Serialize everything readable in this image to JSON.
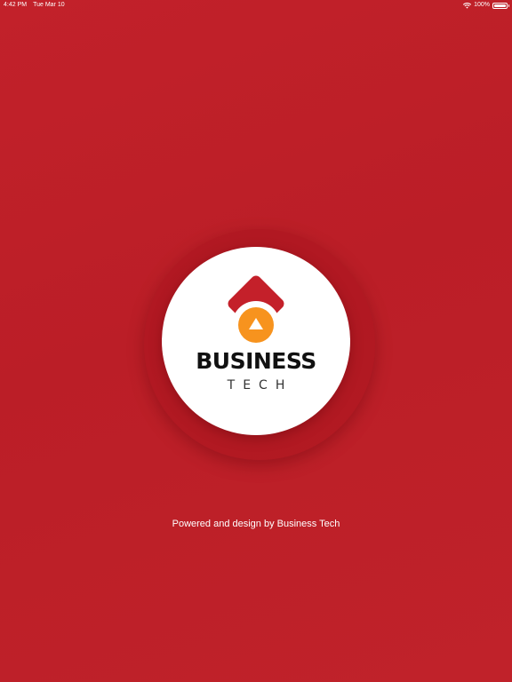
{
  "status_bar": {
    "time": "4:42 PM",
    "date": "Tue Mar 10",
    "battery_text": "100%",
    "battery_level": 1.0,
    "icons": [
      "wifi-icon",
      "battery-icon"
    ]
  },
  "splash": {
    "brand_title": "BUSINESS",
    "brand_subtitle": "TECH",
    "footer": "Powered and design by Business Tech",
    "logo_icons": [
      "diamond-roof-icon",
      "orange-up-triangle-icon"
    ]
  },
  "colors": {
    "background": "#bf2028",
    "logo_red": "#c4202a",
    "logo_orange": "#f7931e",
    "logo_circle": "#ffffff",
    "brand_text": "#111111"
  }
}
